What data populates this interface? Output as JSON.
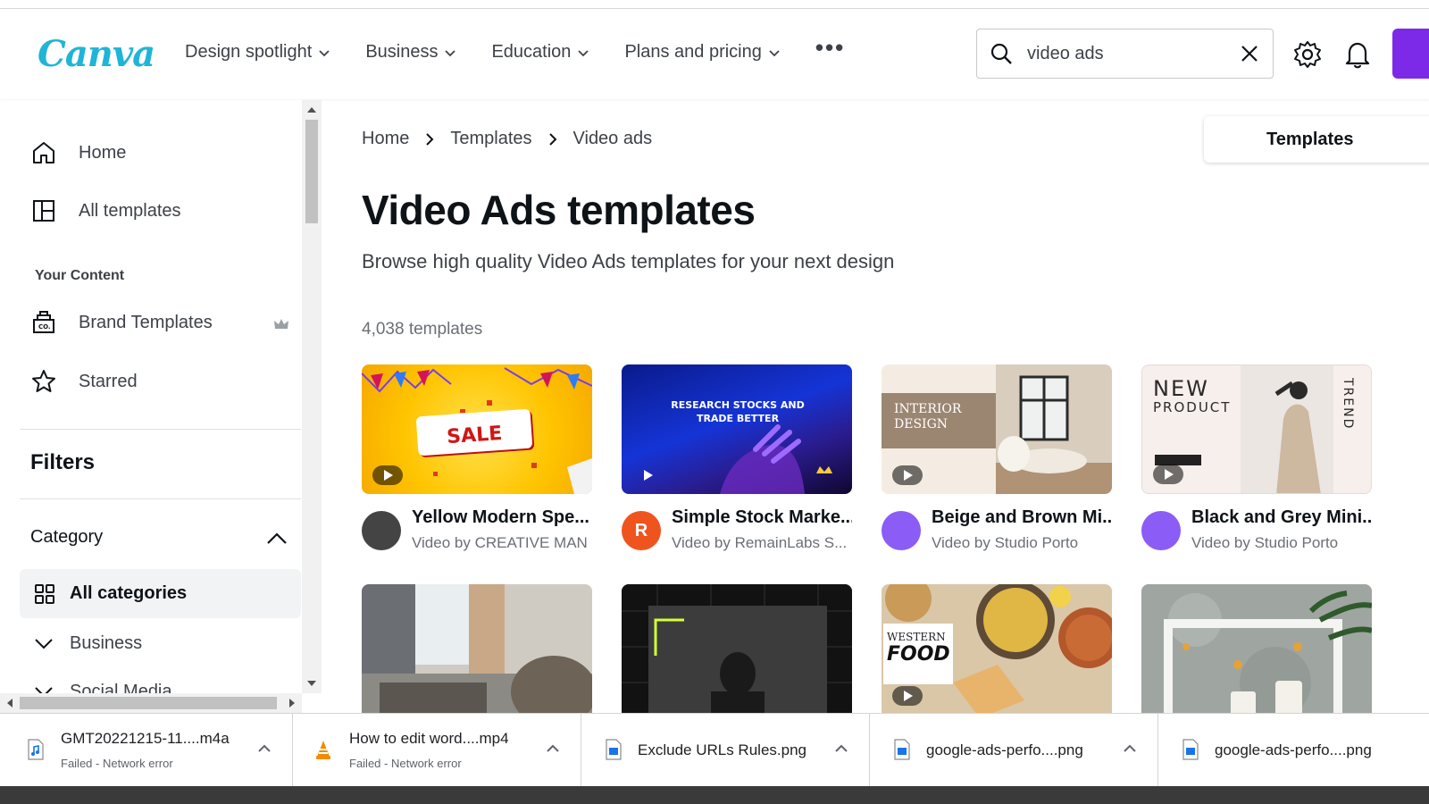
{
  "header": {
    "logo": "Canva",
    "nav": [
      {
        "label": "Design spotlight"
      },
      {
        "label": "Business"
      },
      {
        "label": "Education"
      },
      {
        "label": "Plans and pricing"
      }
    ],
    "more": "•••",
    "search": {
      "value": "video ads"
    }
  },
  "sidebar": {
    "home": "Home",
    "all_templates": "All templates",
    "your_content": "Your Content",
    "brand_templates": "Brand Templates",
    "starred": "Starred",
    "filters": "Filters",
    "category": "Category",
    "all_categories": "All categories",
    "business": "Business",
    "social_media": "Social Media"
  },
  "breadcrumb": [
    "Home",
    "Templates",
    "Video ads"
  ],
  "templates_tab": "Templates",
  "page": {
    "title": "Video Ads templates",
    "subtitle": "Browse high quality Video Ads templates for your next design",
    "count": "4,038 templates"
  },
  "cards": [
    {
      "title": "Yellow Modern Spe...",
      "by": "Video by CREATIVE MAN",
      "avatar_color": "#444444"
    },
    {
      "title": "Simple Stock Marke...",
      "by": "Video by RemainLabs S...",
      "avatar_color": "#f0541e",
      "avatar_text": "R"
    },
    {
      "title": "Beige and Brown Mi...",
      "by": "Video by Studio Porto",
      "avatar_color": "#8b5cf6"
    },
    {
      "title": "Black and Grey Mini...",
      "by": "Video by Studio Porto",
      "avatar_color": "#8b5cf6"
    }
  ],
  "thumb_text": {
    "sale": "SALE",
    "stock": "RESEARCH STOCKS AND TRADE BETTER",
    "interior": "INTERIOR DESIGN",
    "new_product_1": "NEW",
    "new_product_2": "PRODUCT",
    "trend": "TREND",
    "western": "WESTERN",
    "food": "FOOD"
  },
  "downloads": [
    {
      "name": "GMT20221215-11....m4a",
      "status": "Failed - Network error",
      "icon": "audio-file-icon"
    },
    {
      "name": "How to edit word....mp4",
      "status": "Failed - Network error",
      "icon": "vlc-cone-icon"
    },
    {
      "name": "Exclude URLs  Rules.png",
      "status": "",
      "icon": "image-file-icon"
    },
    {
      "name": "google-ads-perfo....png",
      "status": "",
      "icon": "image-file-icon"
    },
    {
      "name": "google-ads-perfo....png",
      "status": "",
      "icon": "image-file-icon"
    }
  ],
  "colors": {
    "brand": "#1fb5d6",
    "accent": "#7d2ae8"
  }
}
